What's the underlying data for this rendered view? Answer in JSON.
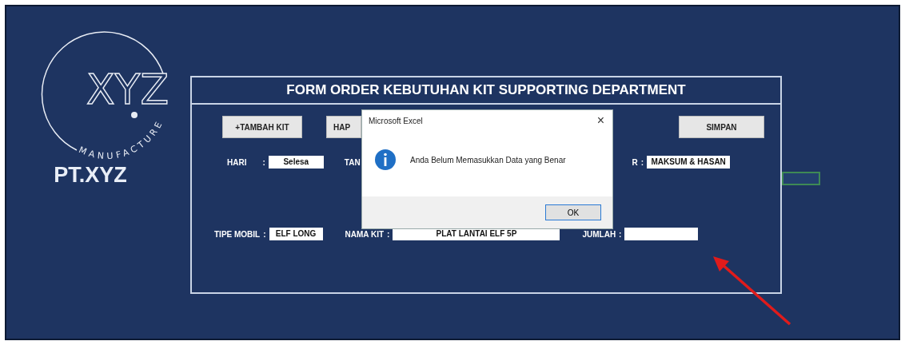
{
  "logo": {
    "mark": "XYZ",
    "ring_text": "MANUFACTURE"
  },
  "company": "PT.XYZ",
  "form": {
    "title": "FORM ORDER KEBUTUHAN KIT SUPPORTING DEPARTMENT",
    "buttons": [
      {
        "label": "+TAMBAH KIT",
        "kind": "left"
      },
      {
        "label": "HAP",
        "kind": "left"
      },
      {
        "label": "SIMPAN",
        "kind": "right"
      }
    ],
    "rows": [
      [
        {
          "kind": "input",
          "label": "HARI",
          "separator": ":",
          "value": "Selesa"
        },
        {
          "kind": "label",
          "label": "TAN"
        },
        {
          "kind": "input",
          "label": "R",
          "separator": ":",
          "value": "MAKSUM & HASAN"
        }
      ],
      [
        {
          "kind": "input",
          "label": "TIPE MOBIL",
          "separator": ":",
          "value": "ELF LONG"
        },
        {
          "kind": "input",
          "label": "NAMA KIT",
          "separator": ":",
          "value": "PLAT LANTAI ELF 5P"
        },
        {
          "kind": "input",
          "label": "JUMLAH",
          "separator": ":"
        }
      ]
    ]
  },
  "dialog": {
    "title": "Microsoft Excel",
    "close": "×",
    "message": "Anda Belum Memasukkan Data yang Benar",
    "button": "OK"
  }
}
